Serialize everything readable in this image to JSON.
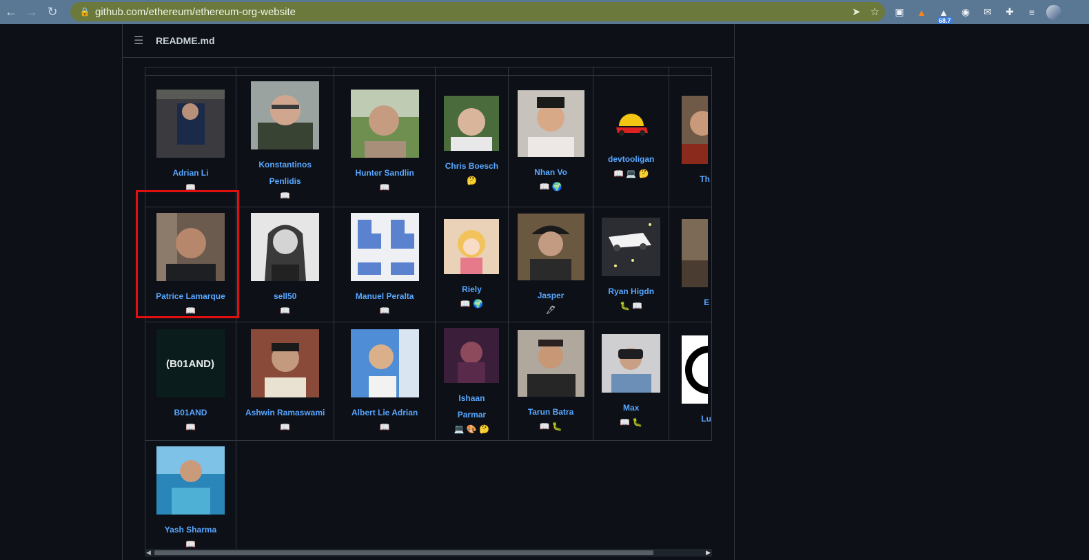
{
  "browser": {
    "url": "github.com/ethereum/ethereum-org-website",
    "badge": "68.7"
  },
  "readme": {
    "title": "README.md"
  },
  "contributors": {
    "row1": [
      {
        "name": "Adrian Li",
        "emoji": "📖"
      },
      {
        "name": "Konstantinos Penlidis",
        "emoji": "📖"
      },
      {
        "name": "Hunter Sandlin",
        "emoji": "📖"
      },
      {
        "name": "Chris Boesch",
        "emoji": "🤔"
      },
      {
        "name": "Nhan Vo",
        "emoji": "📖 🌍"
      },
      {
        "name": "devtooligan",
        "emoji": "📖 💻 🤔"
      },
      {
        "name": "Th",
        "emoji": ""
      }
    ],
    "row2": [
      {
        "name": "Patrice Lamarque",
        "emoji": "📖"
      },
      {
        "name": "sell50",
        "emoji": "📖"
      },
      {
        "name": "Manuel Peralta",
        "emoji": "📖"
      },
      {
        "name": "Riely",
        "emoji": "📖 🌍"
      },
      {
        "name": "Jasper",
        "emoji": "🖋"
      },
      {
        "name": "Ryan Higdn",
        "emoji": "🐛 📖"
      },
      {
        "name": "E",
        "emoji": ""
      }
    ],
    "row3": [
      {
        "name": "B01AND",
        "emoji": "📖"
      },
      {
        "name": "Ashwin Ramaswami",
        "emoji": "📖"
      },
      {
        "name": "Albert Lie Adrian",
        "emoji": "📖"
      },
      {
        "name": "Ishaan Parmar",
        "emoji": "💻 🎨 🤔"
      },
      {
        "name": "Tarun Batra",
        "emoji": "📖 🐛"
      },
      {
        "name": "Max",
        "emoji": "📖 🐛"
      },
      {
        "name": "Lu",
        "emoji": ""
      }
    ],
    "row4": [
      {
        "name": "Yash Sharma",
        "emoji": "📖"
      }
    ],
    "b01and_logo": "(B01AND)"
  }
}
